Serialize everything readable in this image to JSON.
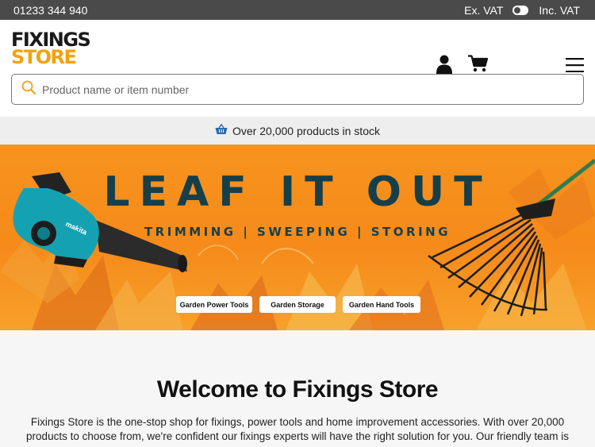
{
  "topbar": {
    "phone": "01233 344 940",
    "vat_ex": "Ex. VAT",
    "vat_inc": "Inc. VAT"
  },
  "header": {
    "logo_line1": "FIXINGS",
    "logo_line2": "STORE",
    "account_icon": "user-icon",
    "cart_icon": "cart-icon",
    "menu_icon": "hamburger-menu-icon"
  },
  "search": {
    "placeholder": "Product name or item number",
    "value": ""
  },
  "stock_bar": {
    "text": "Over 20,000 products in stock",
    "icon": "basket-icon"
  },
  "banner": {
    "title": "LEAF IT OUT",
    "subtitle": "TRIMMING | SWEEPING | STORING",
    "buttons": [
      "Garden Power Tools",
      "Garden Storage",
      "Garden Hand Tools"
    ],
    "blower_brand": "makita"
  },
  "welcome": {
    "heading": "Welcome to Fixings Store",
    "body": "Fixings Store is the one-stop shop for fixings, power tools and home improvement accessories. With over 20,000 products to choose from, we're confident our fixings experts will have the right solution for you. Our friendly team is"
  },
  "colors": {
    "brand_yellow": "#f2a20f",
    "banner_orange": "#f7931e",
    "banner_text": "#153f4a",
    "topbar_bg": "#4a4a4a"
  }
}
